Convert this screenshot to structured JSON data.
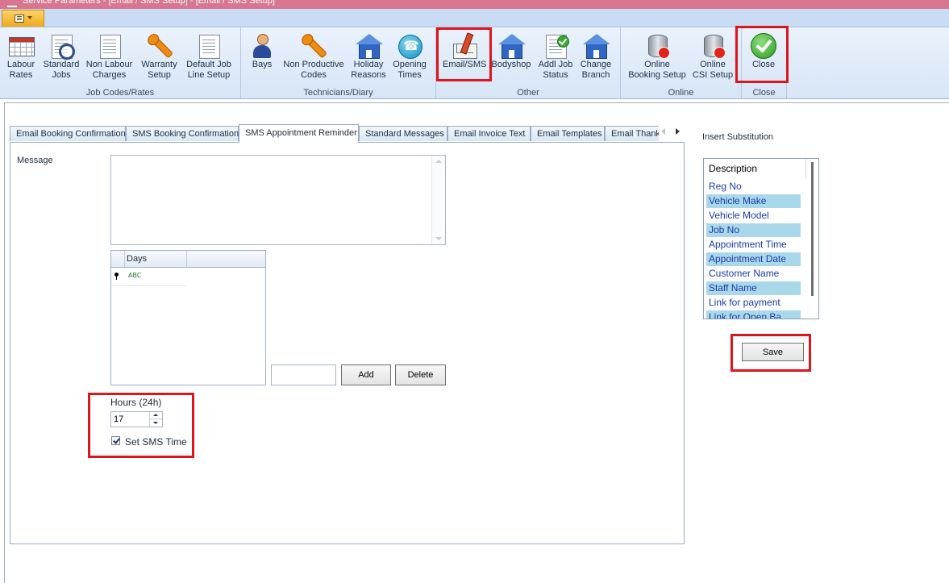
{
  "window": {
    "title": "Service Parameters - [Email / SMS Setup] - [Email / SMS Setup]"
  },
  "ribbon": {
    "groups": [
      {
        "label": "Job Codes/Rates",
        "buttons": [
          {
            "line1": "Labour",
            "line2": "Rates",
            "icon": "labour-rates-icon"
          },
          {
            "line1": "Standard",
            "line2": "Jobs",
            "icon": "standard-jobs-icon"
          },
          {
            "line1": "Non Labour",
            "line2": "Charges",
            "icon": "non-labour-charges-icon"
          },
          {
            "line1": "Warranty",
            "line2": "Setup",
            "icon": "wrench-icon"
          },
          {
            "line1": "Default Job",
            "line2": "Line Setup",
            "icon": "document-wrench-icon"
          }
        ]
      },
      {
        "label": "Technicians/Diary",
        "buttons": [
          {
            "line1": "Bays",
            "line2": "",
            "icon": "person-icon"
          },
          {
            "line1": "Non Productive",
            "line2": "Codes",
            "icon": "wrench-icon"
          },
          {
            "line1": "Holiday",
            "line2": "Reasons",
            "icon": "house-icon"
          },
          {
            "line1": "Opening",
            "line2": "Times",
            "icon": "phone-icon"
          }
        ]
      },
      {
        "label": "Other",
        "buttons": [
          {
            "line1": "Email/SMS",
            "line2": "",
            "icon": "email-pencil-icon"
          },
          {
            "line1": "Bodyshop",
            "line2": "",
            "icon": "house-icon"
          },
          {
            "line1": "Addl Job",
            "line2": "Status",
            "icon": "document-check-icon"
          },
          {
            "line1": "Change",
            "line2": "Branch",
            "icon": "house-icon"
          }
        ]
      },
      {
        "label": "Online",
        "buttons": [
          {
            "line1": "Online",
            "line2": "Booking Setup",
            "icon": "database-error-icon"
          },
          {
            "line1": "Online",
            "line2": "CSI Setup",
            "icon": "database-error-icon"
          }
        ]
      },
      {
        "label": "Close",
        "buttons": [
          {
            "line1": "Close",
            "line2": "",
            "icon": "green-check-icon"
          }
        ]
      }
    ]
  },
  "tabs": [
    {
      "label": "Email Booking Confirmation",
      "active": false
    },
    {
      "label": "SMS Booking Confirmation",
      "active": false
    },
    {
      "label": "SMS Appointment Reminder",
      "active": true
    },
    {
      "label": "Standard Messages",
      "active": false
    },
    {
      "label": "Email Invoice Text",
      "active": false
    },
    {
      "label": "Email Templates",
      "active": false
    },
    {
      "label": "Email Thank",
      "active": false
    }
  ],
  "form": {
    "message_label": "Message",
    "message_value": "",
    "days_grid": {
      "column_header": "Days",
      "new_row_placeholder": "ABC"
    },
    "day_input_value": "",
    "add_label": "Add",
    "delete_label": "Delete",
    "hours_label": "Hours (24h)",
    "hours_value": "17",
    "set_sms_time_label": "Set SMS Time",
    "set_sms_time_checked": true
  },
  "substitution": {
    "title": "Insert Substitution",
    "column_header": "Description",
    "items": [
      "Reg No",
      "Vehicle Make",
      "Vehicle Model",
      "Job No",
      "Appointment Time",
      "Appointment Date",
      "Customer Name",
      "Staff Name",
      "Link for payment",
      "Link for Open Ba"
    ],
    "save_label": "Save"
  },
  "colors": {
    "highlight": "#e0141b",
    "title_bar": "#d8768f",
    "list_alt_row": "#a9d8ea"
  }
}
